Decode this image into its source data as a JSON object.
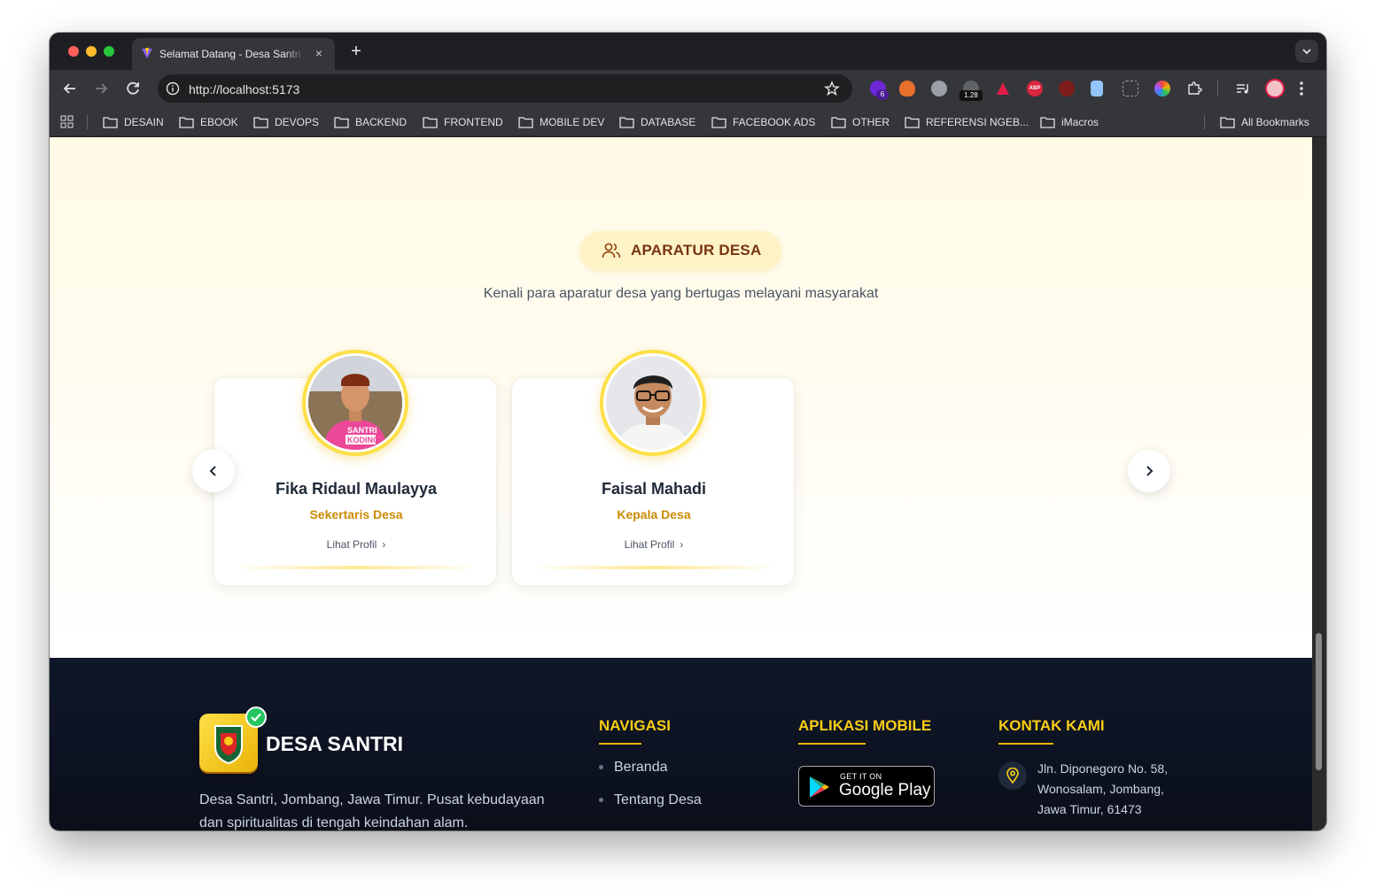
{
  "browser": {
    "tab_title": "Selamat Datang - Desa Santri",
    "tab_close": "×",
    "new_tab": "+",
    "url": "http://localhost:5173",
    "extensions": [
      {
        "name": "ext-badge-6",
        "badge": "6"
      },
      {
        "name": "ext-fox"
      },
      {
        "name": "ext-wing"
      },
      {
        "name": "ext-counter",
        "badge": "1.28"
      },
      {
        "name": "ext-triangle"
      },
      {
        "name": "ext-adblock",
        "badge": "ABP"
      },
      {
        "name": "ext-face"
      },
      {
        "name": "ext-doc"
      },
      {
        "name": "ext-screenshot"
      },
      {
        "name": "ext-color"
      },
      {
        "name": "ext-puzzle"
      }
    ],
    "bookmarks": [
      "DESAIN",
      "EBOOK",
      "DEVOPS",
      "BACKEND",
      "FRONTEND",
      "MOBILE DEV",
      "DATABASE",
      "FACEBOOK ADS",
      "OTHER",
      "REFERENSI NGEB...",
      "iMacros"
    ],
    "all_bookmarks": "All Bookmarks"
  },
  "section": {
    "badge": "APARATUR DESA",
    "subtitle": "Kenali para aparatur desa yang bertugas melayani masyarakat",
    "cards": [
      {
        "name": "Fika Ridaul Maulayya",
        "role": "Sekertaris Desa",
        "link": "Lihat Profil",
        "shirt_text_1": "SANTRI",
        "shirt_text_2": "KODING"
      },
      {
        "name": "Faisal Mahadi",
        "role": "Kepala Desa",
        "link": "Lihat Profil"
      }
    ]
  },
  "footer": {
    "brand": "DESA SANTRI",
    "description": "Desa Santri, Jombang, Jawa Timur. Pusat kebudayaan dan spiritualitas di tengah keindahan alam.",
    "nav_title": "NAVIGASI",
    "nav_items": [
      "Beranda",
      "Tentang Desa"
    ],
    "apps_title": "APLIKASI MOBILE",
    "gplay_small": "GET IT ON",
    "gplay_big": "Google Play",
    "contact_title": "KONTAK KAMI",
    "address": "Jln. Diponegoro No. 58, Wonosalam, Jombang, Jawa Timur, 61473"
  },
  "colors": {
    "accent": "#eab308",
    "badge_bg": "#fef3c7",
    "role_text": "#ca8a04",
    "footer_bg": "#0f172a"
  }
}
